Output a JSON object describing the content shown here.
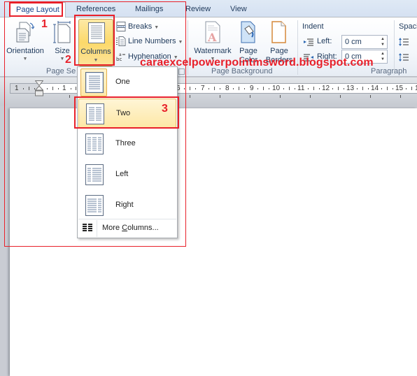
{
  "tabs": [
    {
      "label": "Page Layout",
      "active": true
    },
    {
      "label": "References",
      "active": false
    },
    {
      "label": "Mailings",
      "active": false
    },
    {
      "label": "Review",
      "active": false
    },
    {
      "label": "View",
      "active": false
    }
  ],
  "ribbon": {
    "page_setup": {
      "group_label": "Page Se",
      "orientation": "Orientation",
      "size": "Size",
      "columns": "Columns",
      "breaks": "Breaks",
      "line_numbers": "Line Numbers",
      "hyphenation": "Hyphenation"
    },
    "page_background": {
      "group_label": "Page Background",
      "watermark": "Watermark",
      "page_color_line1": "Page",
      "page_color_line2": "Color",
      "page_borders_line1": "Page",
      "page_borders_line2": "Borders"
    },
    "paragraph": {
      "group_label": "Paragraph",
      "indent_label": "Indent",
      "left_label": "Left:",
      "left_value": "0 cm",
      "right_label": "Right:",
      "right_value": "0 cm",
      "spacing_label": "Spaci"
    }
  },
  "ruler": {
    "numbers": [
      "1",
      "1",
      "6",
      "7",
      "8",
      "9",
      "10",
      "11",
      "12",
      "13",
      "14",
      "15",
      "1"
    ]
  },
  "columns_menu": {
    "items": [
      {
        "label": "One",
        "icon": "one-column-icon",
        "checked": true
      },
      {
        "label": "Two",
        "icon": "two-columns-icon",
        "hovered": true
      },
      {
        "label": "Three",
        "icon": "three-columns-icon"
      },
      {
        "label": "Left",
        "icon": "left-column-icon"
      },
      {
        "label": "Right",
        "icon": "right-column-icon"
      }
    ],
    "more_prefix": "More ",
    "more_underlined": "C",
    "more_suffix": "olumns..."
  },
  "annotations": {
    "step1": "1",
    "step2": "2",
    "step3": "3",
    "watermark_text": "caraexcelpowerpointmsword.blogspot.com",
    "color": "#e8202a"
  }
}
